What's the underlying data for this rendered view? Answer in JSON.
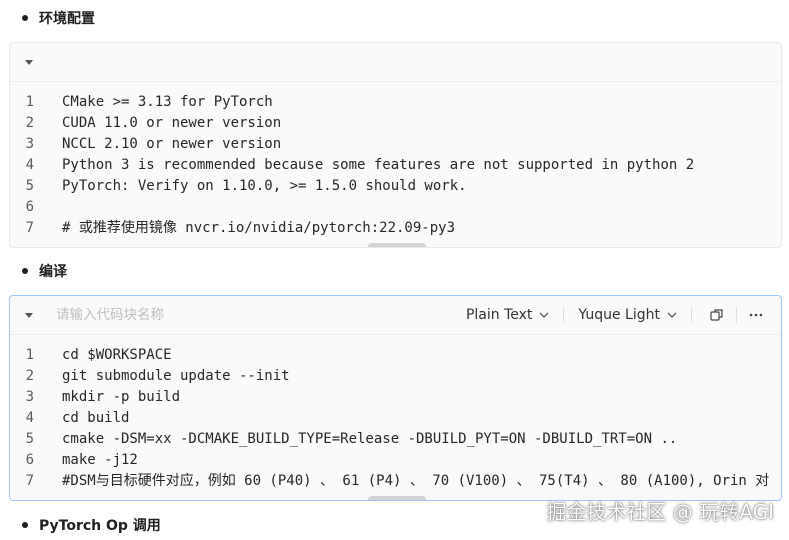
{
  "sections": [
    {
      "title": "环境配置"
    },
    {
      "title": "编译"
    },
    {
      "title": "PyTorch Op 调用"
    }
  ],
  "block1": {
    "lines": [
      {
        "n": "1",
        "code": "CMake >= 3.13 for PyTorch"
      },
      {
        "n": "2",
        "code": "CUDA 11.0 or newer version"
      },
      {
        "n": "3",
        "code": "NCCL 2.10 or newer version"
      },
      {
        "n": "4",
        "code": "Python 3 is recommended because some features are not supported in python 2"
      },
      {
        "n": "5",
        "code": "PyTorch: Verify on 1.10.0, >= 1.5.0 should work."
      },
      {
        "n": "6",
        "code": ""
      },
      {
        "n": "7",
        "code": "# 或推荐使用镜像 nvcr.io/nvidia/pytorch:22.09-py3"
      }
    ]
  },
  "block2": {
    "name_placeholder": "请输入代码块名称",
    "language": "Plain Text",
    "theme": "Yuque Light",
    "lines": [
      {
        "n": "1",
        "code": "cd $WORKSPACE"
      },
      {
        "n": "2",
        "code": "git submodule update --init"
      },
      {
        "n": "3",
        "code": "mkdir -p build"
      },
      {
        "n": "4",
        "code": "cd build"
      },
      {
        "n": "5",
        "code": "cmake -DSM=xx -DCMAKE_BUILD_TYPE=Release -DBUILD_PYT=ON -DBUILD_TRT=ON .."
      },
      {
        "n": "6",
        "code": "make -j12"
      },
      {
        "n": "7",
        "code": "#DSM与目标硬件对应，例如 60 (P40) 、 61 (P4) 、 70 (V100) 、 75(T4) 、 80 (A100), Orin 对"
      }
    ]
  },
  "watermark": "掘金技术社区 @ 玩转AGI",
  "icons": {
    "toggle": "caret-down-icon",
    "select": "chevron-down-icon",
    "copy": "copy-icon",
    "more": "more-dots-icon"
  }
}
